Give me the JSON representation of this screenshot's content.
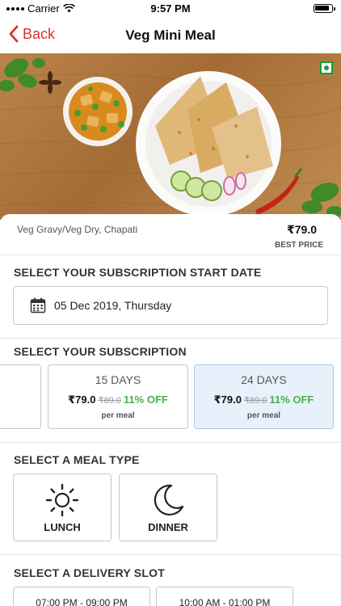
{
  "status_bar": {
    "carrier": "Carrier",
    "time": "9:57 PM"
  },
  "nav": {
    "back_label": "Back",
    "title": "Veg Mini Meal"
  },
  "meal": {
    "description": "Veg Gravy/Veg Dry, Chapati",
    "price": "₹79.0",
    "price_note": "BEST PRICE"
  },
  "start_date": {
    "title": "SELECT YOUR SUBSCRIPTION  START DATE",
    "value": "05 Dec 2019, Thursday"
  },
  "subscription": {
    "title": "SELECT YOUR SUBSCRIPTION",
    "plans": [
      {
        "days": "",
        "price": "",
        "original": "",
        "off": "",
        "unit": "",
        "selected": false
      },
      {
        "days": "15 DAYS",
        "price": "₹79.0",
        "original": "₹89.0",
        "off": "11% OFF",
        "unit": "per meal",
        "selected": false
      },
      {
        "days": "24 DAYS",
        "price": "₹79.0",
        "original": "₹89.0",
        "off": "11% OFF",
        "unit": "per meal",
        "selected": true
      }
    ]
  },
  "meal_type": {
    "title": "SELECT A MEAL TYPE",
    "options": [
      {
        "label": "LUNCH",
        "icon": "sun-icon"
      },
      {
        "label": "DINNER",
        "icon": "moon-icon"
      }
    ]
  },
  "delivery_slot": {
    "title": "SELECT A DELIVERY SLOT",
    "slots": [
      {
        "label": "07:00 PM - 09:00 PM"
      },
      {
        "label": "10:00 AM - 01:00 PM"
      }
    ]
  },
  "colors": {
    "accent": "#d8352a",
    "selected_bg": "#e7f1fb",
    "discount": "#4cae4c",
    "veg_green": "#1d9a32"
  }
}
